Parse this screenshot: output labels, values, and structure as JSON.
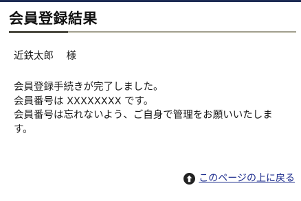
{
  "header": {
    "title": "会員登録結果"
  },
  "main": {
    "recipient_name": "近鉄太郎",
    "honorific": "様",
    "message_lines": [
      "会員登録手続きが完了しました。",
      "会員番号は XXXXXXXX です。",
      "会員番号は忘れないよう、ご自身で管理をお願いいたしま",
      "す。"
    ]
  },
  "footer": {
    "back_to_top_label": "このページの上に戻る",
    "back_to_top_icon": "arrow-up-circle-icon"
  },
  "colors": {
    "header_rule": "#1d2c54",
    "link": "#1a2a8c"
  }
}
